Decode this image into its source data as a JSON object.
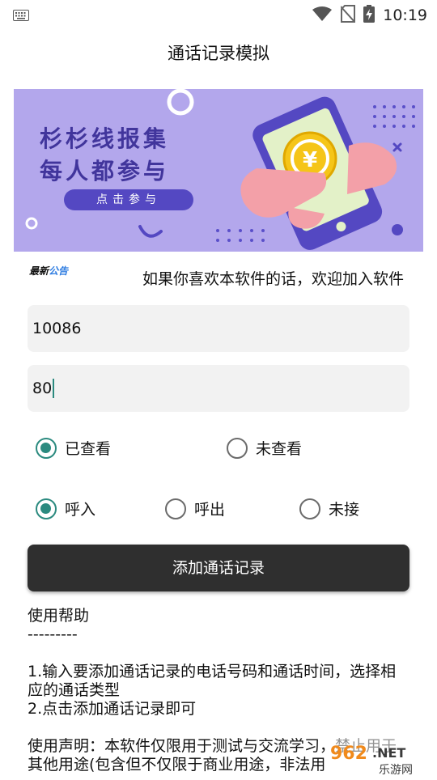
{
  "status_bar": {
    "time": "10:19",
    "icons": [
      "keyboard-icon",
      "wifi-icon",
      "no-sim-icon",
      "battery-charging-icon"
    ]
  },
  "app_bar": {
    "title": "通话记录模拟"
  },
  "banner": {
    "line1": "杉杉线报集",
    "line2": "每人都参与",
    "cta": "点击参与",
    "icon": "phone-yen-coin-icon"
  },
  "notice": {
    "badge_main": "最新",
    "badge_accent": "公告",
    "text": "如果你喜欢本软件的话，欢迎加入软件"
  },
  "form": {
    "phone_value": "10086",
    "duration_value": "80",
    "read_status": {
      "options": [
        "已查看",
        "未查看"
      ],
      "selected": 0
    },
    "call_type": {
      "options": [
        "呼入",
        "呼出",
        "未接"
      ],
      "selected": 0
    },
    "submit_label": "添加通话记录"
  },
  "help": {
    "title": "使用帮助",
    "divider": "---------",
    "step1": "1.输入要添加通话记录的电话号码和通话时间，选择相应的通话类型",
    "step2": "2.点击添加通话记录即可",
    "disclaimer": "使用声明：本软件仅限用于测试与交流学习，禁止用于其他用途(包含但不仅限于商业用途，非法用"
  },
  "watermark": {
    "number": "962",
    "suffix": ".NET",
    "site": "乐游网"
  }
}
